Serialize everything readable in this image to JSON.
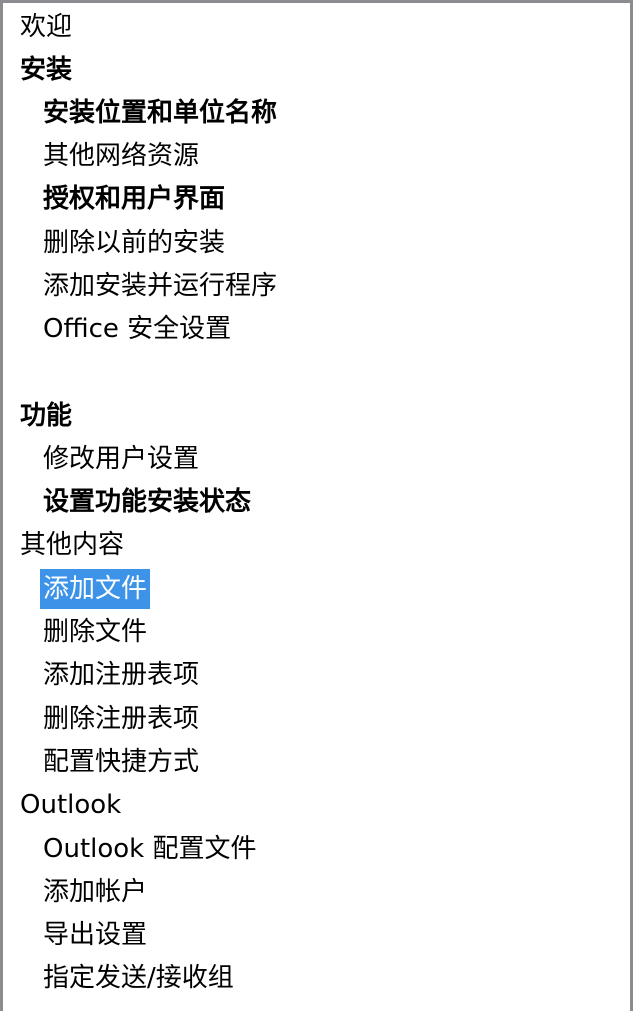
{
  "colors": {
    "border": "#8c8b90",
    "background": "#ffffff",
    "text": "#000000",
    "selection_bg": "#3c93e8",
    "selection_text": "#ffffff"
  },
  "tree": {
    "items": [
      {
        "label": "欢迎",
        "level": 0,
        "bold": false,
        "selected": false
      },
      {
        "label": "安装",
        "level": 0,
        "bold": true,
        "selected": false
      },
      {
        "label": "安装位置和单位名称",
        "level": 1,
        "bold": true,
        "selected": false
      },
      {
        "label": "其他网络资源",
        "level": 1,
        "bold": false,
        "selected": false
      },
      {
        "label": "授权和用户界面",
        "level": 1,
        "bold": true,
        "selected": false
      },
      {
        "label": "删除以前的安装",
        "level": 1,
        "bold": false,
        "selected": false
      },
      {
        "label": "添加安装并运行程序",
        "level": 1,
        "bold": false,
        "selected": false
      },
      {
        "label": "Office 安全设置",
        "level": 1,
        "bold": false,
        "selected": false
      },
      {
        "label": "",
        "level": 0,
        "bold": false,
        "selected": false
      },
      {
        "label": "功能",
        "level": 0,
        "bold": true,
        "selected": false
      },
      {
        "label": "修改用户设置",
        "level": 1,
        "bold": false,
        "selected": false
      },
      {
        "label": "设置功能安装状态",
        "level": 1,
        "bold": true,
        "selected": false
      },
      {
        "label": "其他内容",
        "level": 0,
        "bold": false,
        "selected": false
      },
      {
        "label": "添加文件",
        "level": 1,
        "bold": false,
        "selected": true
      },
      {
        "label": "删除文件",
        "level": 1,
        "bold": false,
        "selected": false
      },
      {
        "label": "添加注册表项",
        "level": 1,
        "bold": false,
        "selected": false
      },
      {
        "label": "删除注册表项",
        "level": 1,
        "bold": false,
        "selected": false
      },
      {
        "label": "配置快捷方式",
        "level": 1,
        "bold": false,
        "selected": false
      },
      {
        "label": "Outlook",
        "level": 0,
        "bold": false,
        "selected": false
      },
      {
        "label": "Outlook 配置文件",
        "level": 1,
        "bold": false,
        "selected": false
      },
      {
        "label": "添加帐户",
        "level": 1,
        "bold": false,
        "selected": false
      },
      {
        "label": "导出设置",
        "level": 1,
        "bold": false,
        "selected": false
      },
      {
        "label": "指定发送/接收组",
        "level": 1,
        "bold": false,
        "selected": false
      }
    ]
  }
}
